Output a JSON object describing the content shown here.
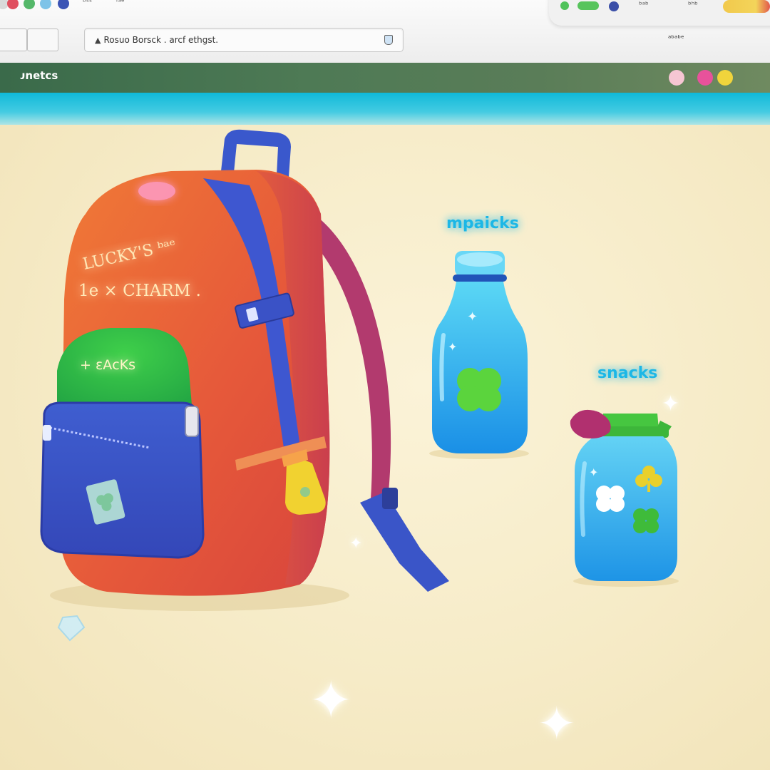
{
  "browser": {
    "tab_small_1": "ᵇˢˢ",
    "tab_small_2": "ʳᵃᵉ",
    "right_small_1": "ᵇᵃᵇ",
    "right_small_2": "ᵇʰᵇ",
    "address": "Rosuo Borsck . arcf ethgst.",
    "nav_right_label": "ᵃᵇᵃᵇᵉ"
  },
  "page": {
    "title": "ᴊnetᴄs"
  },
  "backpack": {
    "lines": [
      "LUCKY'S ᵇᵃᵉ",
      "1e × CHARM ."
    ],
    "pocket_label": "+ ɛAᴄKs"
  },
  "bottle": {
    "label": "mpaicks"
  },
  "jar": {
    "label": "snacks"
  },
  "colors": {
    "water": "#2bc2e0",
    "sand": "#f6ebc7",
    "backpack": "#e65a39",
    "strap": "#3d56c8",
    "label": "#18b6e6",
    "clover": "#52d13a"
  }
}
